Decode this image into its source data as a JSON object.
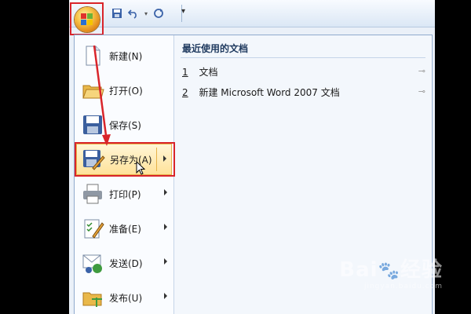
{
  "qat": {
    "save_icon": "save-icon",
    "undo_icon": "undo-icon",
    "redo_icon": "redo-icon",
    "customize_icon": "customize-qat-icon"
  },
  "menu": {
    "items": [
      {
        "label": "新建(N)",
        "icon": "new-document-icon",
        "has_submenu": false
      },
      {
        "label": "打开(O)",
        "icon": "open-folder-icon",
        "has_submenu": false
      },
      {
        "label": "保存(S)",
        "icon": "save-icon",
        "has_submenu": false
      },
      {
        "label": "另存为(A)",
        "icon": "save-as-icon",
        "has_submenu": true,
        "active": true
      },
      {
        "label": "打印(P)",
        "icon": "print-icon",
        "has_submenu": true
      },
      {
        "label": "准备(E)",
        "icon": "prepare-icon",
        "has_submenu": true
      },
      {
        "label": "发送(D)",
        "icon": "send-icon",
        "has_submenu": true
      },
      {
        "label": "发布(U)",
        "icon": "publish-icon",
        "has_submenu": true
      }
    ]
  },
  "recent": {
    "title": "最近使用的文档",
    "documents": [
      {
        "num": "1",
        "name": "文档"
      },
      {
        "num": "2",
        "name": "新建 Microsoft Word 2007 文档"
      }
    ]
  },
  "watermark": {
    "text": "Bai",
    "suffix": "经验",
    "sub": "jingyan.baidu.com"
  },
  "colors": {
    "highlight": "#d9242a",
    "active_bg": "#ffe29a",
    "office_button": "#e38a1a"
  }
}
